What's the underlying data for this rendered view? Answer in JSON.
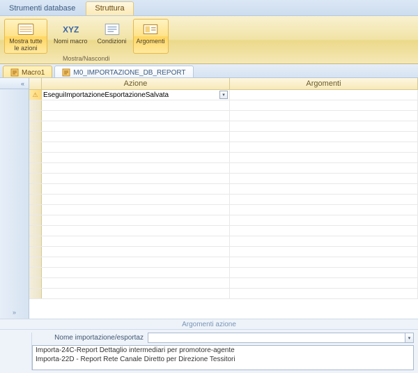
{
  "tabs": {
    "db_tools": "Strumenti database",
    "structure": "Struttura"
  },
  "ribbon": {
    "show_all_actions": "Mostra tutte\nle azioni",
    "macro_names": "Nomi\nmacro",
    "conditions": "Condizioni",
    "arguments": "Argomenti",
    "group_label": "Mostra/Nascondi"
  },
  "doc_tabs": {
    "macro1": "Macro1",
    "import_report": "M0_IMPORTAZIONE_DB_REPORT"
  },
  "grid": {
    "col_action": "Azione",
    "col_arguments": "Argomenti",
    "row1_action": "EseguiImportazioneEsportazioneSalvata"
  },
  "args": {
    "caption": "Argomenti azione",
    "label_import_name": "Nome importazione/esportaz",
    "field_value": "",
    "options": [
      "Importa-24C-Report Dettaglio intermediari per promotore-agente",
      "Importa-22D - Report Rete Canale Diretto per Direzione Tessitori"
    ]
  },
  "nav": {
    "toggle_glyph": "«",
    "expand_glyph": "»"
  }
}
